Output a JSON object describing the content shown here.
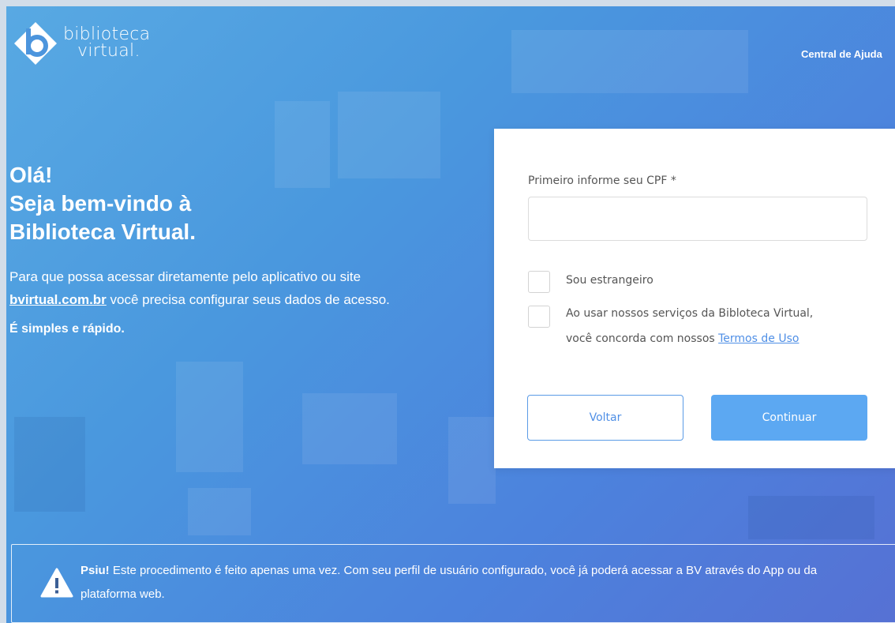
{
  "header": {
    "logo": {
      "line1": "biblioteca",
      "line2": "virtual."
    },
    "help_link": "Central de Ajuda"
  },
  "welcome": {
    "line1": "Olá!",
    "line2": "Seja bem-vindo à",
    "line3": "Biblioteca Virtual.",
    "desc_before": "Para que possa acessar diretamente pelo aplicativo ou site ",
    "desc_link": "bvirtual.com.br",
    "desc_after": " você precisa configurar seus dados de acesso.",
    "simple": "É simples e rápido."
  },
  "form": {
    "cpf_label": "Primeiro informe seu CPF *",
    "cpf_value": "",
    "foreigner_label": "Sou estrangeiro",
    "foreigner_checked": false,
    "terms_text_line1": "Ao usar nossos serviços da Bibloteca Virtual,",
    "terms_text_line2": "você concorda com nossos ",
    "terms_link": "Termos de Uso",
    "terms_checked": false,
    "back_button": "Voltar",
    "continue_button": "Continuar"
  },
  "notice": {
    "icon": "warning-icon",
    "bold": "Psiu!",
    "text": " Este procedimento é feito apenas uma vez. Com seu perfil de usuário configurado, você já poderá acessar a BV através do App ou da plataforma web."
  },
  "colors": {
    "bg_start": "#58a9e3",
    "bg_end": "#5671d4",
    "primary_button": "#5ca8f2",
    "link": "#4f8fe6"
  }
}
